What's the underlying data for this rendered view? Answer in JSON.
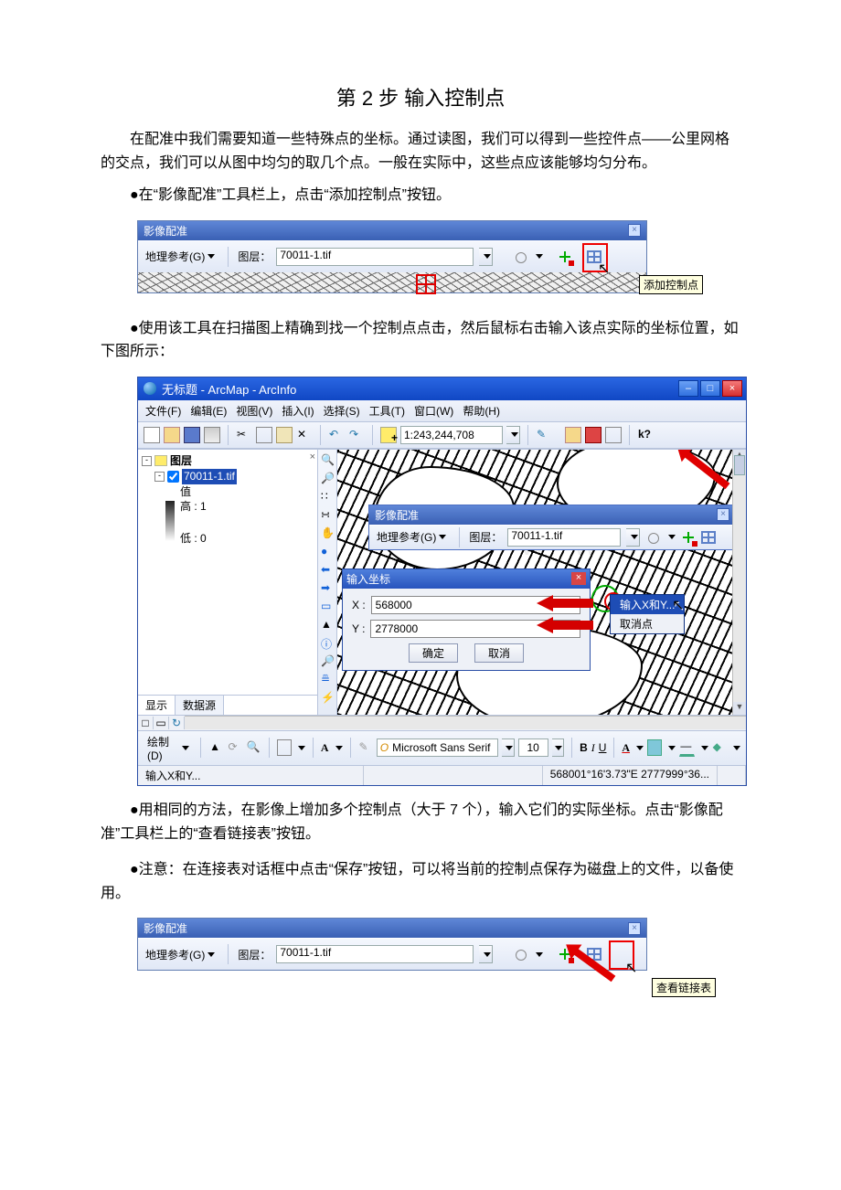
{
  "title": "第 2 步 输入控制点",
  "para_intro": "在配准中我们需要知道一些特殊点的坐标。通过读图，我们可以得到一些控件点——公里网格的交点，我们可以从图中均匀的取几个点。一般在实际中，这些点应该能够均匀分布。",
  "bullet1": "●在“影像配准”工具栏上，点击“添加控制点”按钮。",
  "bullet2": "●使用该工具在扫描图上精确到找一个控制点点击，然后鼠标右击输入该点实际的坐标位置，如下图所示：",
  "bullet3": "●用相同的方法，在影像上增加多个控制点（大于 7 个），输入它们的实际坐标。点击“影像配准”工具栏上的“查看链接表”按钮。",
  "bullet4": "●注意：在连接表对话框中点击“保存”按钮，可以将当前的控制点保存为磁盘上的文件，以备使用。",
  "georef": {
    "toolbar_title": "影像配准",
    "menu_label": "地理参考(G)",
    "layer_label": "图层：",
    "layer_value": "70011-1.tif",
    "tooltip_add": "添加控制点",
    "tooltip_table": "查看链接表"
  },
  "arcmap": {
    "title": "无标题 - ArcMap - ArcInfo",
    "menu": {
      "file": "文件(F)",
      "edit": "编辑(E)",
      "view": "视图(V)",
      "insert": "插入(I)",
      "select": "选择(S)",
      "tools": "工具(T)",
      "window": "窗口(W)",
      "help": "帮助(H)"
    },
    "scale": "1:243,244,708",
    "toc": {
      "root": "图层",
      "layer": "70011-1.tif",
      "val_label": "值",
      "high": "高 : 1",
      "low": "低 : 0",
      "tab_display": "显示",
      "tab_source": "数据源"
    },
    "coord_dialog": {
      "title": "输入坐标",
      "x_label": "X :",
      "x_value": "568000",
      "y_label": "Y :",
      "y_value": "2778000",
      "ok": "确定",
      "cancel": "取消"
    },
    "context_menu": {
      "item1": "输入X和Y...",
      "item2": "取消点"
    },
    "draw_label": "绘制(D)",
    "font_name": "Microsoft Sans Serif",
    "font_size": "10",
    "status_left": "输入X和Y...",
    "status_coord": "568001°16'3.73\"E  2777999°36..."
  }
}
